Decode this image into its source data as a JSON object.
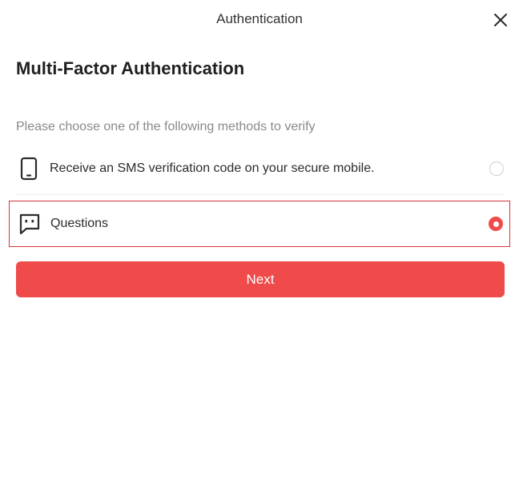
{
  "window": {
    "title": "Authentication",
    "close_icon": "close-icon"
  },
  "main": {
    "heading": "Multi-Factor Authentication",
    "instruction": "Please choose one of the following methods to verify",
    "options": [
      {
        "label": "Receive an SMS verification code on your secure mobile.",
        "icon": "mobile-phone-icon",
        "selected": false
      },
      {
        "label": "Questions",
        "icon": "chat-bubble-icon",
        "selected": true
      }
    ],
    "next_label": "Next"
  },
  "colors": {
    "accent": "#ef4b4b",
    "selected_border": "#d7323a",
    "muted_text": "#8a8a8a"
  }
}
